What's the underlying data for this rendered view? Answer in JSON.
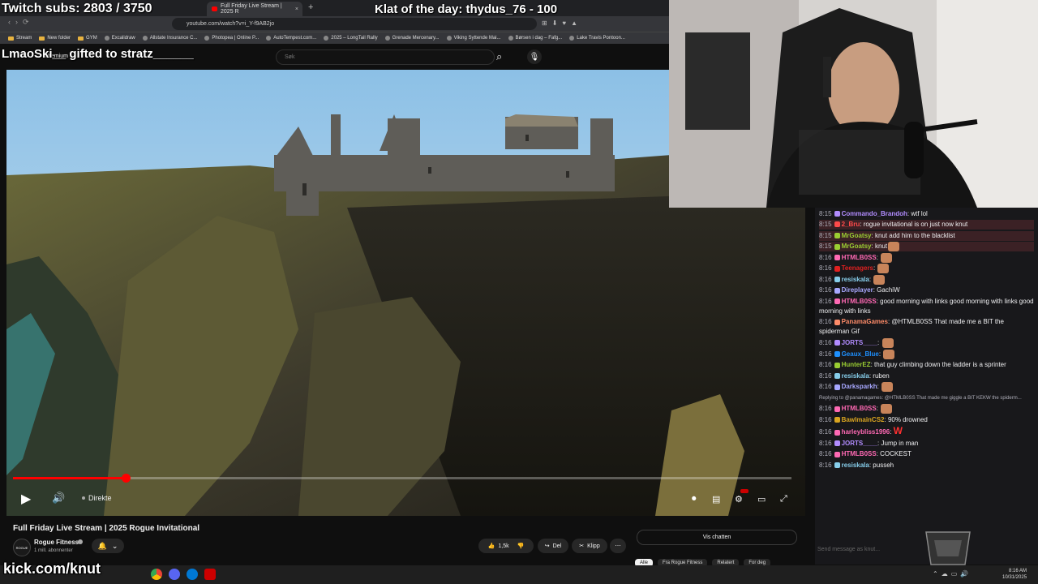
{
  "overlay": {
    "subs_text": "Twitch subs: 2803 / 3750",
    "klat_text": "Klat of the day: thydus_76 - 100",
    "gift_text": "LmaoSki__ gifted to stratz______",
    "kick_text": "kick.com/knut"
  },
  "browser": {
    "tab_title": "Full Friday Live Stream | 2025 R",
    "tab_close": "×",
    "new_tab": "+",
    "url": "youtube.com/watch?v=i_Y-f9AB2jo",
    "bookmarks": [
      "Stream",
      "New folder",
      "GYM",
      "Excalidraw",
      "Allstate Insurance C...",
      "Photopea | Online P...",
      "AutoTempest.com...",
      "2025 – LongTail Rally",
      "Grenade Mercenary...",
      "Viking Syttende Mai...",
      "Børsen i dag – Fafg...",
      "Lake Travis Pontoon..."
    ]
  },
  "youtube": {
    "logo_text": "Premium",
    "search_placeholder": "Søk",
    "live_label": "Direkte",
    "progress_fraction": 0.145,
    "video_title": "Full Friday Live Stream | 2025 Rogue Invitational",
    "channel_avatar_text": "ROGUE",
    "channel_name": "Rogue Fitness",
    "channel_subs": "1 mill. abonnenter",
    "like_count": "1,5k",
    "share_label": "Del",
    "clip_label": "Klipp",
    "more_label": "⋯",
    "vis_chatten": "Vis chatten",
    "chips": [
      "Alle",
      "Fra Rogue Fitness",
      "Relatert",
      "For deg"
    ]
  },
  "chat": {
    "messages": [
      {
        "ts": "8:15",
        "user": "Commando_Brandoh",
        "color": "#b28cff",
        "msg": "wtf lol"
      },
      {
        "ts": "8:15",
        "user": "2_Bru",
        "color": "#ff4a4a",
        "msg": "rogue invitational is on just now knut",
        "hl": true
      },
      {
        "ts": "8:15",
        "user": "MrGoatsy",
        "color": "#9acd32",
        "msg": "knut add him to the blacklist",
        "hl": true
      },
      {
        "ts": "8:15",
        "user": "MrGoatsy",
        "color": "#9acd32",
        "msg": "knut",
        "hl": true,
        "emote": true
      },
      {
        "ts": "8:16",
        "user": "HTMLB0SS",
        "color": "#ff69b4",
        "msg": "",
        "emote": true
      },
      {
        "ts": "8:16",
        "user": "Teenagers",
        "color": "#e02020",
        "msg": "",
        "emote": true
      },
      {
        "ts": "8:16",
        "user": "resiskala",
        "color": "#87ceeb",
        "msg": "",
        "emote": true
      },
      {
        "ts": "8:16",
        "user": "Direplayer",
        "color": "#a8a8ff",
        "msg": "GachiW"
      },
      {
        "ts": "8:16",
        "user": "HTMLB0SS",
        "color": "#ff69b4",
        "msg": "good morning with links good morning with links good morning with links",
        "wrap": true
      },
      {
        "ts": "8:16",
        "user": "PanamaGames",
        "color": "#ff8c69",
        "msg": "@HTMLB0SS That made me a BIT the spiderman Gif",
        "wrap": true
      },
      {
        "ts": "8:16",
        "user": "JORTS____",
        "color": "#b28cff",
        "msg": "",
        "emote": true
      },
      {
        "ts": "8:16",
        "user": "Geaux_Blue",
        "color": "#1e90ff",
        "msg": "",
        "emote": true
      },
      {
        "ts": "8:16",
        "user": "HunterEZ",
        "color": "#9acd32",
        "msg": "that guy climbing down the ladder is a sprinter"
      },
      {
        "ts": "8:16",
        "user": "resiskala",
        "color": "#87ceeb",
        "msg": "ruben"
      },
      {
        "ts": "8:16",
        "user": "Darksparkh",
        "color": "#a8a8ff",
        "msg": "",
        "emote": true
      },
      {
        "ts": "",
        "user": "",
        "color": "#adadb8",
        "msg": "Replying to @panamagames: @HTMLB0SS That made me giggle a BIT KEKW the spiderm...",
        "reply": true
      },
      {
        "ts": "8:16",
        "user": "HTMLB0SS",
        "color": "#ff69b4",
        "msg": "",
        "emote": true
      },
      {
        "ts": "8:16",
        "user": "BawlmainCS2",
        "color": "#daa520",
        "msg": "90% drowned"
      },
      {
        "ts": "8:16",
        "user": "harleybliss1996",
        "color": "#ff69b4",
        "msg": "W"
      },
      {
        "ts": "8:16",
        "user": "JORTS____",
        "color": "#b28cff",
        "msg": "Jump in man"
      },
      {
        "ts": "8:16",
        "user": "HTMLB0SS",
        "color": "#ff69b4",
        "msg": "COCKEST"
      },
      {
        "ts": "8:16",
        "user": "resiskala",
        "color": "#87ceeb",
        "msg": "pusseh"
      }
    ],
    "input_placeholder": "Send message as knut..."
  },
  "tray": {
    "time": "8:16 AM",
    "date": "10/31/2025"
  },
  "colors": {
    "accent_red": "#ff0000",
    "chat_bg": "#18181b"
  }
}
